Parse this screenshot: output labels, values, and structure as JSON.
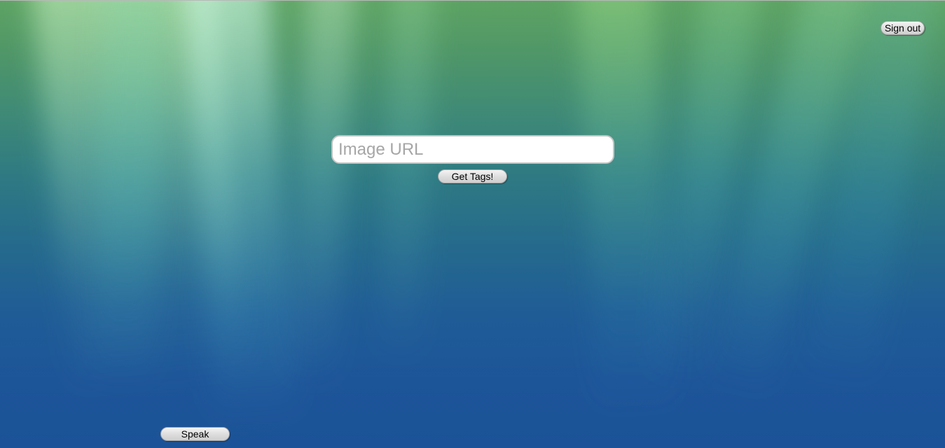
{
  "header": {
    "signout_label": "Sign out"
  },
  "main": {
    "image_url_input": {
      "value": "",
      "placeholder": "Image URL"
    },
    "get_tags_label": "Get Tags!"
  },
  "footer": {
    "speak_label": "Speak"
  },
  "colors": {
    "background_top": "#5da363",
    "background_bottom": "#1c5398",
    "button_face": "#dcdcdc"
  }
}
